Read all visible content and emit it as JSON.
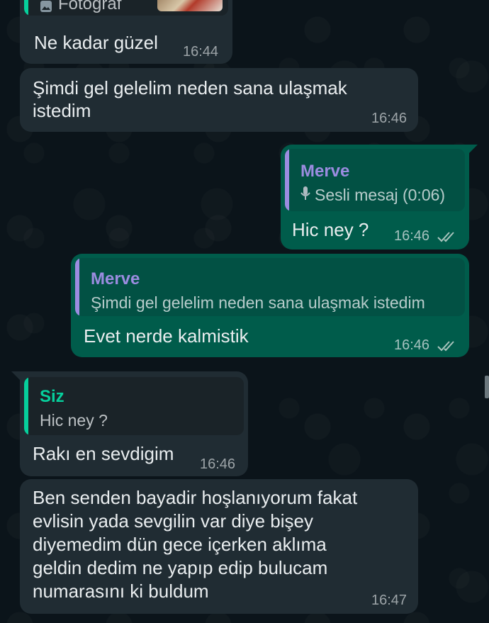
{
  "messages": [
    {
      "caption": "Fotoğraf",
      "text": "Ne kadar güzel",
      "time": "16:44"
    },
    {
      "text_line1": "Şimdi gel gelelim neden sana ulaşmak",
      "text_line2": "istedim",
      "time": "16:46"
    },
    {
      "quote_author": "Merve",
      "quote_text": "Sesli mesaj (0:06)",
      "text": "Hic ney ?",
      "time": "16:46"
    },
    {
      "quote_author": "Merve",
      "quote_text": "Şimdi gel gelelim neden sana ulaşmak istedim",
      "text": "Evet nerde kalmistik",
      "time": "16:46"
    },
    {
      "quote_author": "Siz",
      "quote_text": "Hic ney ?",
      "text": "Rakı en sevdigim",
      "time": "16:46"
    },
    {
      "lines": [
        "Ben senden bayadir hoşlanıyorum fakat",
        "evlisin yada sevgilin var diye bişey",
        "diyemedim dün gece içerken aklıma",
        "geldin dedim ne yapıp edip bulucam",
        "numarasını ki buldum"
      ],
      "time": "16:47"
    }
  ],
  "colors": {
    "incoming": "#202c33",
    "outgoing": "#005c4b",
    "quote_merve": "#9b8ce0",
    "quote_self": "#06cf9c",
    "read_ticks": "#a9c4bd"
  },
  "icons": [
    "photo-icon",
    "mic-icon",
    "double-check-icon"
  ]
}
